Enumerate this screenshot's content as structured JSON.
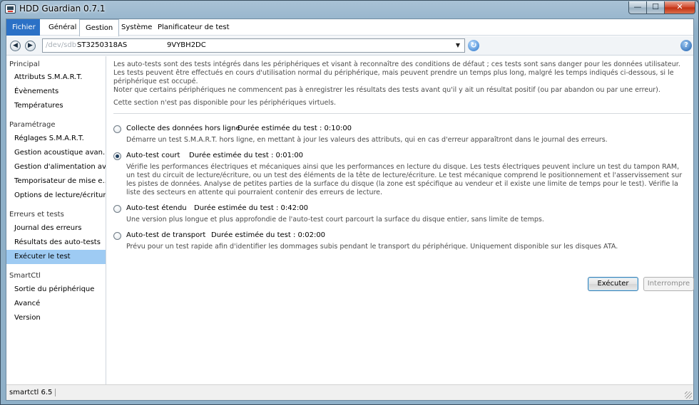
{
  "window": {
    "title": "HDD Guardian 0.7.1",
    "min": "—",
    "max": "☐",
    "close": "✕"
  },
  "menubar": {
    "file": "Fichier",
    "items": [
      "Général",
      "Gestion",
      "Système",
      "Planificateur de test"
    ],
    "active": "Gestion"
  },
  "toolbar": {
    "back_icon": "◀",
    "forward_icon": "▶",
    "device_path": "/dev/sdb",
    "device_model": "ST3250318AS",
    "device_serial": "9VYBH2DC",
    "dropdown_icon": "▼",
    "refresh_icon": "↻",
    "help_icon": "?"
  },
  "sidebar": {
    "groups": [
      {
        "label": "Principal",
        "items": [
          "Attributs S.M.A.R.T.",
          "Évènements",
          "Températures"
        ]
      },
      {
        "label": "Paramétrage",
        "items": [
          "Réglages S.M.A.R.T.",
          "Gestion acoustique avan...",
          "Gestion d'alimentation av...",
          "Temporisateur de mise e...",
          "Options de lecture/écriture"
        ]
      },
      {
        "label": "Erreurs et tests",
        "items": [
          "Journal des erreurs",
          "Résultats des auto-tests",
          "Exécuter le test"
        ]
      },
      {
        "label": "SmartCtl",
        "items": [
          "Sortie du périphérique",
          "Avancé",
          "Version"
        ]
      }
    ],
    "selected": "Exécuter le test"
  },
  "main": {
    "intro": [
      "Les auto-tests sont des tests intégrés dans les périphériques et visant à reconnaître des conditions de défaut ; ces tests sont sans danger pour les données utilisateur. Les tests peuvent être effectués en cours d'utilisation normal du périphérique, mais peuvent prendre un temps plus long, malgré les temps indiqués ci-dessous, si le périphérique est occupé.",
      "Noter que certains périphériques ne commencent pas à enregistrer les résultats des tests avant qu'il y ait un résultat positif (ou par abandon ou par une erreur)."
    ],
    "virtual_note": "Cette section n'est pas disponible pour les périphériques virtuels.",
    "tests": [
      {
        "title": "Collecte des données hors ligne",
        "duration": "Durée estimée du test : 0:10:00",
        "description": "Démarre un test S.M.A.R.T. hors ligne, en mettant à jour les valeurs des attributs, qui en cas d'erreur apparaîtront dans le journal des erreurs.",
        "checked": false
      },
      {
        "title": "Auto-test court",
        "duration": "Durée estimée du test : 0:01:00",
        "description": "Vérifie les performances électriques et mécaniques ainsi que les performances en lecture du disque. Les tests électriques peuvent inclure un test du tampon RAM, un test du circuit de lecture/écriture, ou un test des éléments de la tête de lecture/écriture. Le test mécanique comprend le positionnement et l'asservissement sur les pistes de données. Analyse de petites parties de la surface du disque (la zone est spécifique au vendeur et il existe une limite de temps pour le test). Vérifie la liste des secteurs en attente qui pourraient contenir des erreurs de lecture.",
        "checked": true
      },
      {
        "title": "Auto-test étendu",
        "duration": "Durée estimée du test : 0:42:00",
        "description": "Une version plus longue et plus approfondie de l'auto-test court parcourt la surface du disque entier, sans limite de temps.",
        "checked": false
      },
      {
        "title": "Auto-test de transport",
        "duration": "Durée estimée du test : 0:02:00",
        "description": "Prévu pour un test rapide afin d'identifier les dommages subis pendant le transport du périphérique. Uniquement disponible sur les disques ATA.",
        "checked": false
      }
    ],
    "run_button": "Exécuter",
    "stop_button": "Interrompre"
  },
  "statusbar": {
    "text": "smartctl 6.5"
  },
  "colors": {
    "selection": "#9ecbf3",
    "file_menu": "#2b71c6"
  }
}
